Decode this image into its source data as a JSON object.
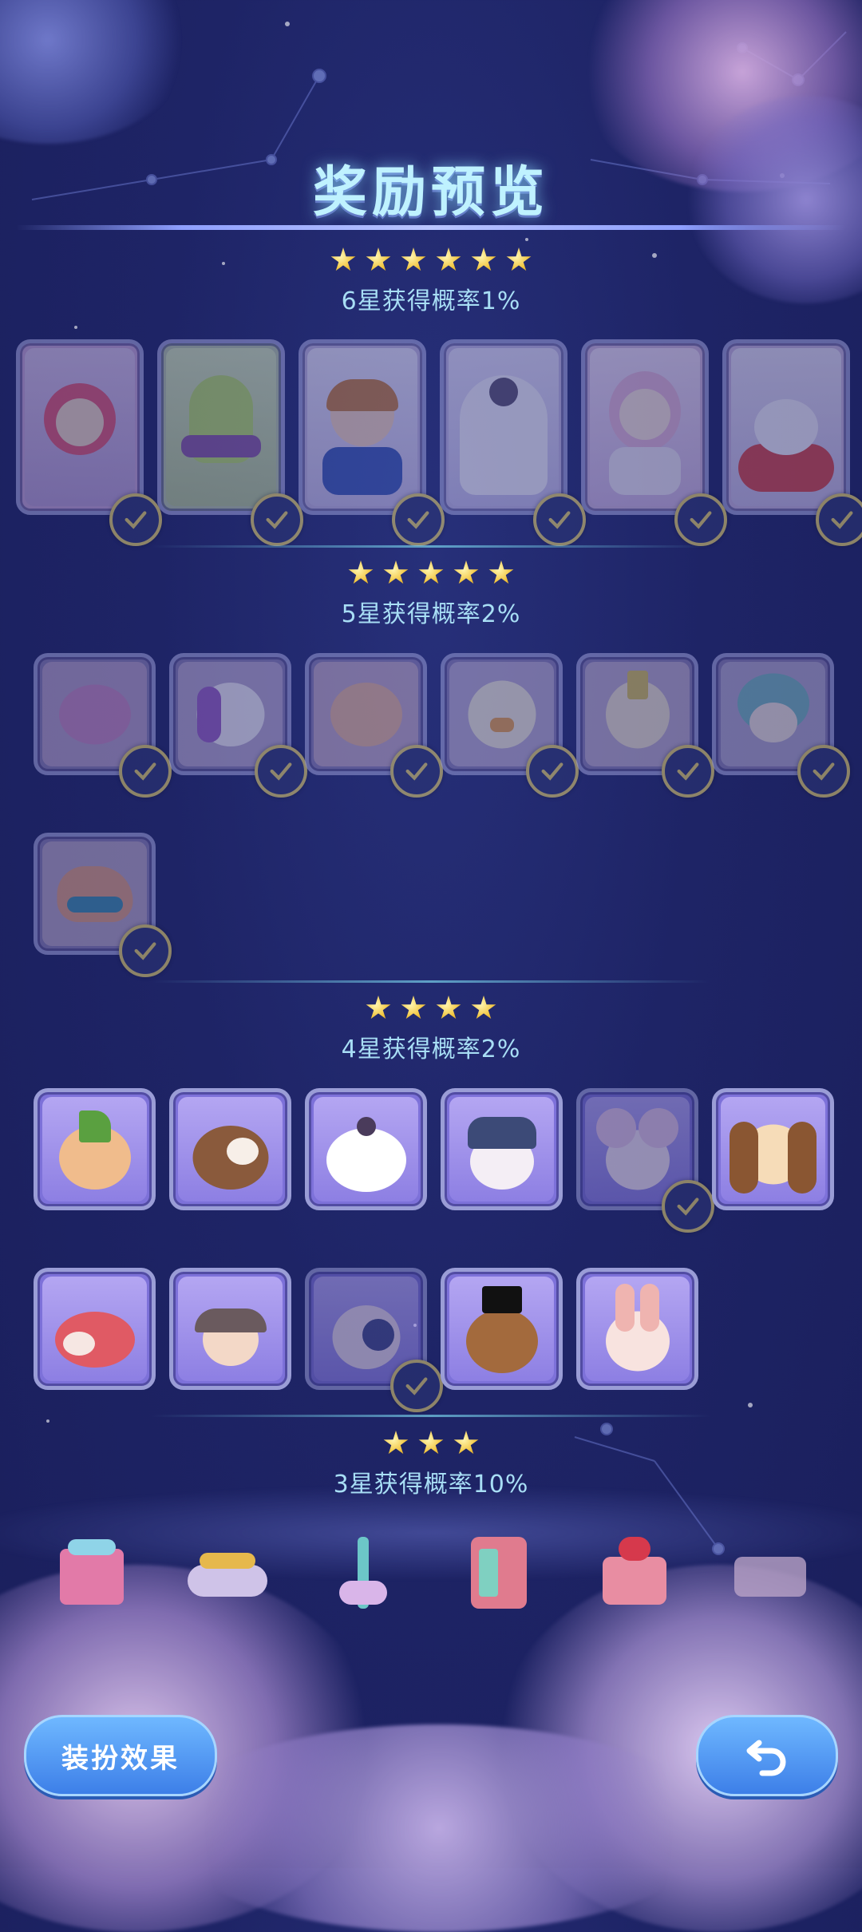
{
  "title": "奖励预览",
  "tiers": [
    {
      "stars": 6,
      "label": "6星获得概率1%"
    },
    {
      "stars": 5,
      "label": "5星获得概率2%"
    },
    {
      "stars": 4,
      "label": "4星获得概率2%"
    },
    {
      "stars": 3,
      "label": "3星获得概率10%"
    }
  ],
  "buttons": {
    "costume_effect": "装扮效果",
    "back_icon": "back-arrow-icon"
  },
  "colors": {
    "accent": "#6fb8ff",
    "title_glow": "#bff2ff",
    "tier_text": "#a8def5",
    "check_ring": "#e8d36c"
  }
}
